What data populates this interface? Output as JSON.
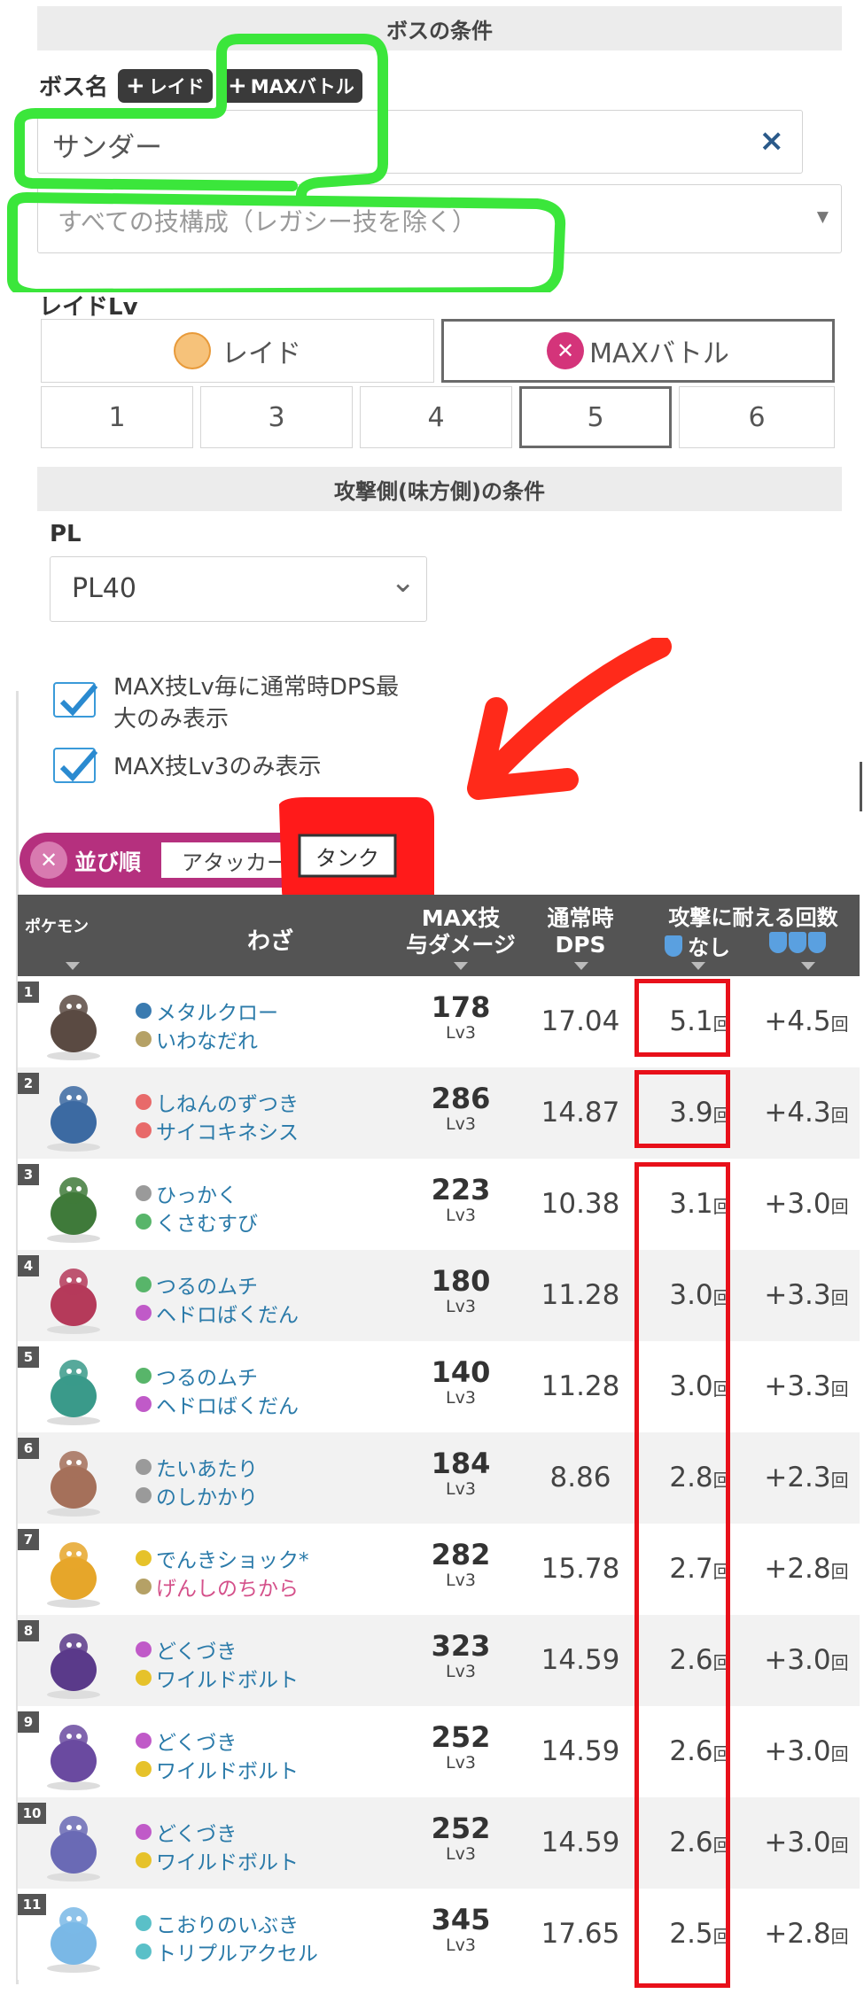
{
  "boss_section": {
    "title": "ボスの条件"
  },
  "boss_name": {
    "label": "ボス名",
    "tag_raid": "レイド",
    "tag_max": "MAXバトル",
    "value": "サンダー",
    "clear": "×"
  },
  "move_set": {
    "placeholder": "すべての技構成（レガシー技を除く）",
    "arrow": "▼"
  },
  "raid_level": {
    "label": "レイドLv",
    "type_raid": "レイド",
    "type_max": "MAXバトル",
    "levels": [
      "1",
      "3",
      "4",
      "5",
      "6"
    ],
    "selected_level": "5",
    "selected_type": "MAXバトル"
  },
  "attacker_section": {
    "title": "攻撃側(味方側)の条件"
  },
  "pl": {
    "label": "PL",
    "value": "PL40",
    "chevron": "⌄"
  },
  "options": {
    "opt1_line1": "MAX技Lv毎に通常時DPS最",
    "opt1_line2": "大のみ表示",
    "opt1_checked": true,
    "opt2": "MAX技Lv3のみ表示",
    "opt2_checked": true
  },
  "sort": {
    "label": "並び順",
    "attacker": "アタッカー",
    "tank": "タンク",
    "selected": "タンク"
  },
  "table_header": {
    "pokemon": "ポケモン",
    "moves": "わざ",
    "max_dmg_1": "MAX技",
    "max_dmg_2": "与ダメージ",
    "dps_1": "通常時",
    "dps_2": "DPS",
    "endure": "攻撃に耐える回数",
    "none": "なし"
  },
  "rows": [
    {
      "rank": "1",
      "fast": "メタルクロー",
      "charged": "いわなだれ",
      "dmg": "178",
      "lv": "Lv3",
      "dps": "17.04",
      "none": "5.1",
      "shield": "+4.5",
      "unit": "回",
      "c1": "#3a7bb0",
      "c2": "#b5a166",
      "pk": "#5a4a42"
    },
    {
      "rank": "2",
      "fast": "しねんのずつき",
      "charged": "サイコキネシス",
      "dmg": "286",
      "lv": "Lv3",
      "dps": "14.87",
      "none": "3.9",
      "shield": "+4.3",
      "unit": "回",
      "c1": "#e86a6a",
      "c2": "#e86a6a",
      "pk": "#3c6aa2"
    },
    {
      "rank": "3",
      "fast": "ひっかく",
      "charged": "くさむすび",
      "dmg": "223",
      "lv": "Lv3",
      "dps": "10.38",
      "none": "3.1",
      "shield": "+3.0",
      "unit": "回",
      "c1": "#9a9a9a",
      "c2": "#58b56a",
      "pk": "#3f7a3a"
    },
    {
      "rank": "4",
      "fast": "つるのムチ",
      "charged": "ヘドロばくだん",
      "dmg": "180",
      "lv": "Lv3",
      "dps": "11.28",
      "none": "3.0",
      "shield": "+3.3",
      "unit": "回",
      "c1": "#58b56a",
      "c2": "#c05ac8",
      "pk": "#b53a5a"
    },
    {
      "rank": "5",
      "fast": "つるのムチ",
      "charged": "ヘドロばくだん",
      "dmg": "140",
      "lv": "Lv3",
      "dps": "11.28",
      "none": "3.0",
      "shield": "+3.3",
      "unit": "回",
      "c1": "#58b56a",
      "c2": "#c05ac8",
      "pk": "#3a9a8a"
    },
    {
      "rank": "6",
      "fast": "たいあたり",
      "charged": "のしかかり",
      "dmg": "184",
      "lv": "Lv3",
      "dps": "8.86",
      "none": "2.8",
      "shield": "+2.3",
      "unit": "回",
      "c1": "#9a9a9a",
      "c2": "#9a9a9a",
      "pk": "#a5705a"
    },
    {
      "rank": "7",
      "fast": "でんきショック*",
      "charged": "げんしのちから",
      "dmg": "282",
      "lv": "Lv3",
      "dps": "15.78",
      "none": "2.7",
      "shield": "+2.8",
      "unit": "回",
      "c1": "#e6c22a",
      "c2": "#b5a166",
      "pk": "#e6a62a",
      "pink": true
    },
    {
      "rank": "8",
      "fast": "どくづき",
      "charged": "ワイルドボルト",
      "dmg": "323",
      "lv": "Lv3",
      "dps": "14.59",
      "none": "2.6",
      "shield": "+3.0",
      "unit": "回",
      "c1": "#c05ac8",
      "c2": "#e6c22a",
      "pk": "#5a3a8a"
    },
    {
      "rank": "9",
      "fast": "どくづき",
      "charged": "ワイルドボルト",
      "dmg": "252",
      "lv": "Lv3",
      "dps": "14.59",
      "none": "2.6",
      "shield": "+3.0",
      "unit": "回",
      "c1": "#c05ac8",
      "c2": "#e6c22a",
      "pk": "#6a4aa0"
    },
    {
      "rank": "10",
      "fast": "どくづき",
      "charged": "ワイルドボルト",
      "dmg": "252",
      "lv": "Lv3",
      "dps": "14.59",
      "none": "2.6",
      "shield": "+3.0",
      "unit": "回",
      "c1": "#c05ac8",
      "c2": "#e6c22a",
      "pk": "#6a6ab5"
    },
    {
      "rank": "11",
      "fast": "こおりのいぶき",
      "charged": "トリプルアクセル",
      "dmg": "345",
      "lv": "Lv3",
      "dps": "17.65",
      "none": "2.5",
      "shield": "+2.8",
      "unit": "回",
      "c1": "#5ac0c8",
      "c2": "#5ac0c8",
      "pk": "#7ab8e6"
    }
  ]
}
